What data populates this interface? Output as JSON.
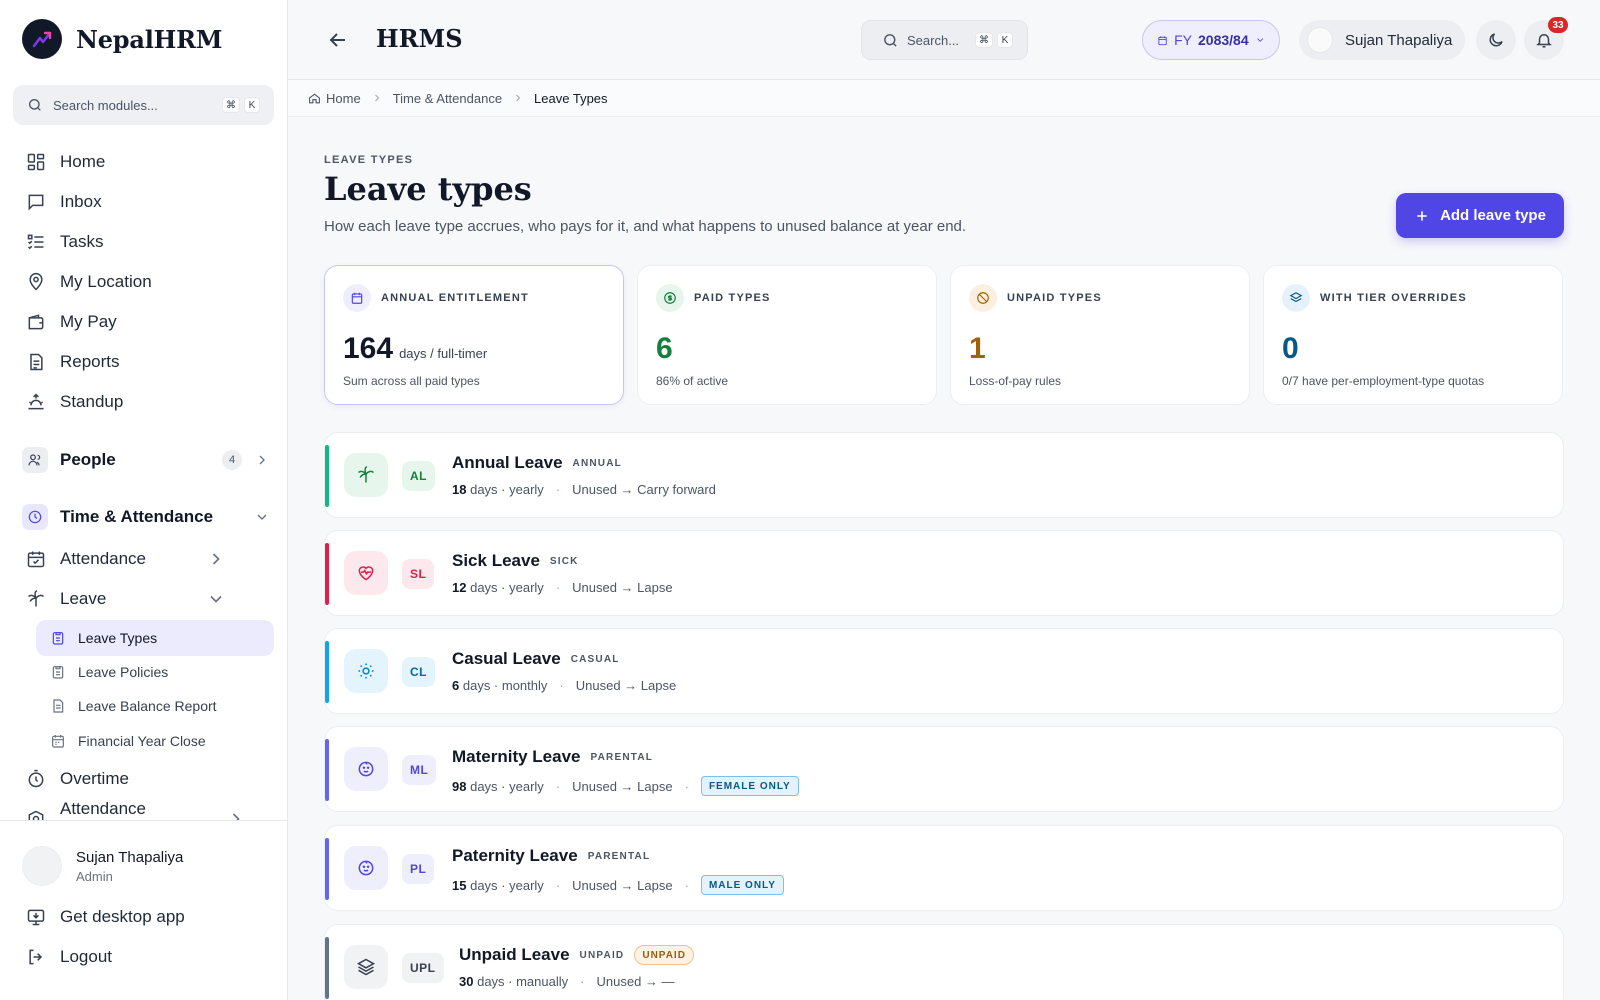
{
  "brand": {
    "name": "NepalHRM"
  },
  "sidebar": {
    "search_placeholder": "Search modules...",
    "search_kbd": [
      "⌘",
      "K"
    ],
    "items": [
      {
        "label": "Home",
        "icon": "grid-icon"
      },
      {
        "label": "Inbox",
        "icon": "message-icon"
      },
      {
        "label": "Tasks",
        "icon": "list-check-icon"
      },
      {
        "label": "My Location",
        "icon": "map-pin-icon"
      },
      {
        "label": "My Pay",
        "icon": "wallet-icon"
      },
      {
        "label": "Reports",
        "icon": "document-icon"
      },
      {
        "label": "Standup",
        "icon": "sunrise-icon"
      }
    ],
    "people": {
      "label": "People",
      "count": "4"
    },
    "time_group": {
      "label": "Time & Attendance"
    },
    "attendance": {
      "label": "Attendance"
    },
    "leave": {
      "label": "Leave"
    },
    "leave_sub": [
      {
        "label": "Leave Types",
        "active": true
      },
      {
        "label": "Leave Policies"
      },
      {
        "label": "Leave Balance Report"
      },
      {
        "label": "Financial Year Close"
      }
    ],
    "overtime": {
      "label": "Overtime"
    },
    "attendance_settings": {
      "label": "Attendance Settings"
    },
    "footer": {
      "user_name": "Sujan Thapaliya",
      "user_role": "Admin",
      "desktop_app": "Get desktop app",
      "logout": "Logout"
    }
  },
  "header": {
    "title": "HRMS",
    "search_placeholder": "Search...",
    "search_kbd": [
      "⌘",
      "K"
    ],
    "fy_prefix": "FY",
    "fy_value": "2083/84",
    "user_name": "Sujan Thapaliya",
    "notif_count": "33"
  },
  "breadcrumb": {
    "home": "Home",
    "section": "Time & Attendance",
    "current": "Leave Types"
  },
  "page": {
    "eyebrow": "LEAVE TYPES",
    "title": "Leave types",
    "description": "How each leave type accrues, who pays for it, and what happens to unused balance at year end.",
    "add_button": "Add leave type"
  },
  "stats": [
    {
      "label": "ANNUAL ENTITLEMENT",
      "value": "164",
      "unit": "days / full-timer",
      "sub": "Sum across all paid types",
      "color": "#111827"
    },
    {
      "label": "PAID TYPES",
      "value": "6",
      "unit": "",
      "sub": "86% of active",
      "color": "#15803d"
    },
    {
      "label": "UNPAID TYPES",
      "value": "1",
      "unit": "",
      "sub": "Loss-of-pay rules",
      "color": "#a16207"
    },
    {
      "label": "WITH TIER OVERRIDES",
      "value": "0",
      "unit": "",
      "sub": "0/7 have per-employment-type quotas",
      "color": "#075985"
    }
  ],
  "leave_types": [
    {
      "name": "Annual Leave",
      "category": "ANNUAL",
      "code": "AL",
      "days": "18",
      "days_suffix": "days · yearly",
      "unused": "Unused → Carry forward",
      "tag": "",
      "accent": "#10b981"
    },
    {
      "name": "Sick Leave",
      "category": "SICK",
      "code": "SL",
      "days": "12",
      "days_suffix": "days · yearly",
      "unused": "Unused → Lapse",
      "tag": "",
      "accent": "#e11d48"
    },
    {
      "name": "Casual Leave",
      "category": "CASUAL",
      "code": "CL",
      "days": "6",
      "days_suffix": "days · monthly",
      "unused": "Unused → Lapse",
      "tag": "",
      "accent": "#0ea5e9"
    },
    {
      "name": "Maternity Leave",
      "category": "PARENTAL",
      "code": "ML",
      "days": "98",
      "days_suffix": "days · yearly",
      "unused": "Unused → Lapse",
      "tag": "FEMALE ONLY",
      "accent": "#6366f1"
    },
    {
      "name": "Paternity Leave",
      "category": "PARENTAL",
      "code": "PL",
      "days": "15",
      "days_suffix": "days · yearly",
      "unused": "Unused → Lapse",
      "tag": "MALE ONLY",
      "accent": "#6366f1"
    },
    {
      "name": "Unpaid Leave",
      "category": "UNPAID",
      "code": "UPL",
      "days": "30",
      "days_suffix": "days · manually",
      "unused": "Unused → —",
      "tag": "UNPAID",
      "accent": "#64748b"
    }
  ]
}
